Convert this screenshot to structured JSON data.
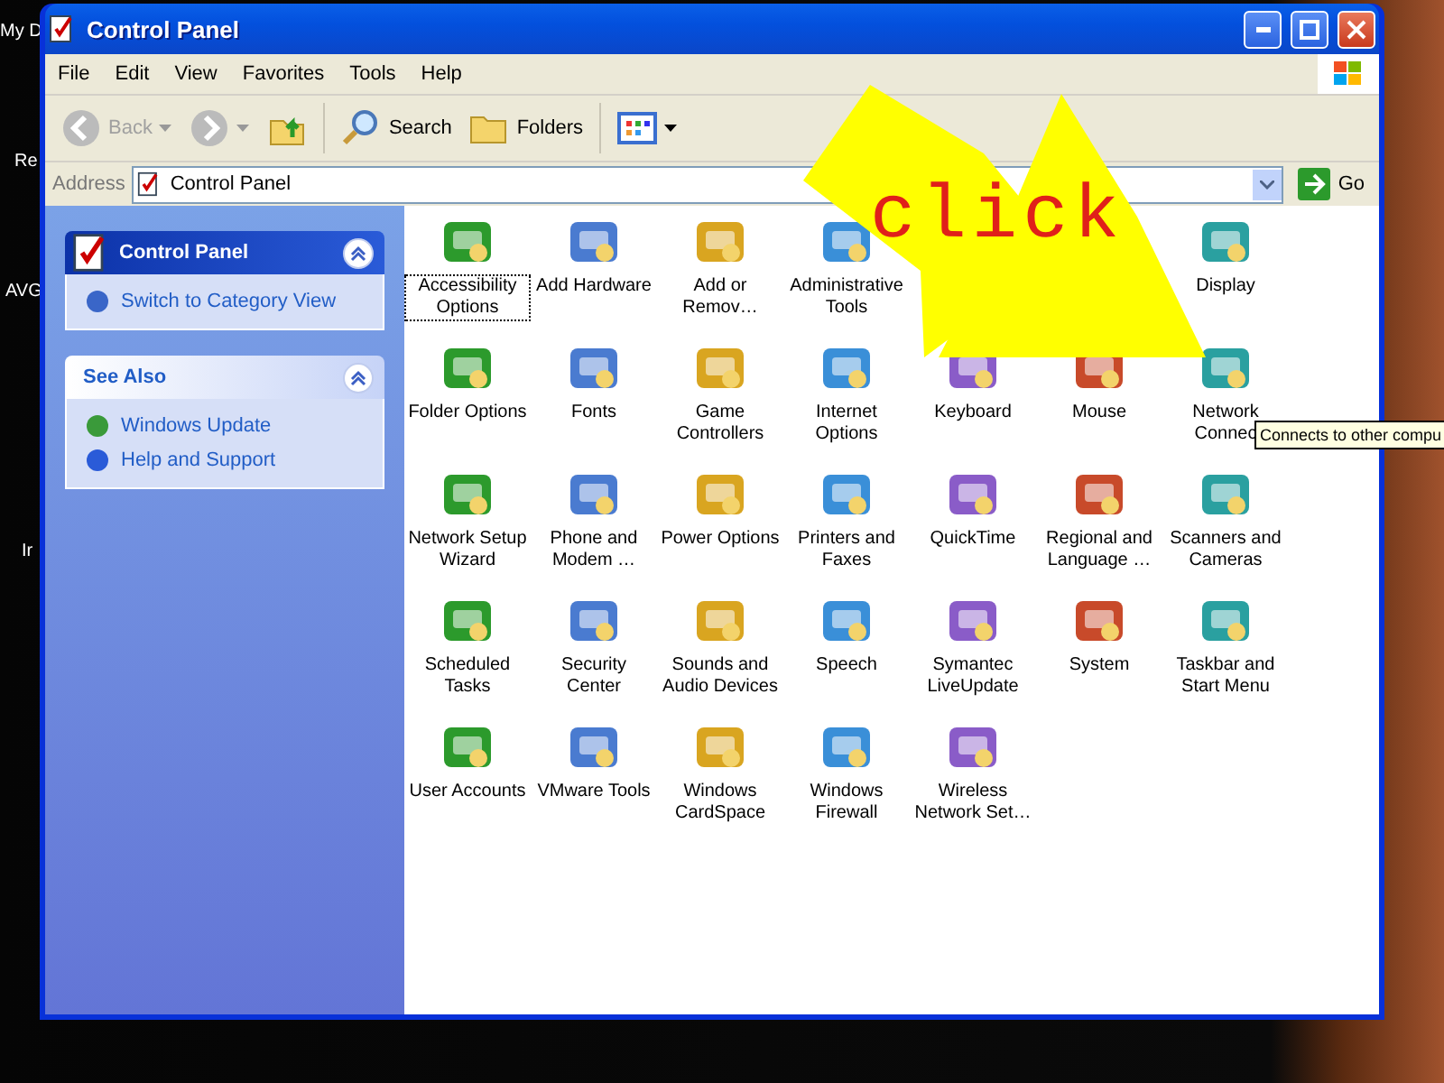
{
  "desktop": {
    "labels": [
      "My D",
      "Re",
      "AVG",
      "Ir"
    ]
  },
  "window": {
    "title": "Control Panel"
  },
  "menu": [
    "File",
    "Edit",
    "View",
    "Favorites",
    "Tools",
    "Help"
  ],
  "toolbar": {
    "back": {
      "label": "Back",
      "disabled": true
    },
    "forward": {
      "disabled": true
    },
    "search": "Search",
    "folders": "Folders"
  },
  "address": {
    "label": "Address",
    "value": "Control Panel",
    "go": "Go"
  },
  "sidebar": {
    "panels": [
      {
        "kind": "main",
        "title": "Control Panel",
        "links": [
          "Switch to Category View"
        ]
      },
      {
        "kind": "plain",
        "title": "See Also",
        "links": [
          "Windows Update",
          "Help and Support"
        ]
      }
    ]
  },
  "items": [
    {
      "kind": "icon",
      "label": "Accessibility Options",
      "selected": true
    },
    {
      "kind": "icon",
      "label": "Add Hardware",
      "selected": false
    },
    {
      "kind": "icon",
      "label": "Add or Remov…",
      "selected": false
    },
    {
      "kind": "icon",
      "label": "Administrative Tools",
      "selected": false
    },
    {
      "kind": "covered"
    },
    {
      "kind": "covered"
    },
    {
      "kind": "icon",
      "label": "Display",
      "selected": false
    },
    {
      "kind": "icon",
      "label": "Folder Options",
      "selected": false
    },
    {
      "kind": "icon",
      "label": "Fonts",
      "selected": false
    },
    {
      "kind": "icon",
      "label": "Game Controllers",
      "selected": false
    },
    {
      "kind": "icon",
      "label": "Internet Options",
      "selected": false
    },
    {
      "kind": "icon",
      "label": "Keyboard",
      "selected": false
    },
    {
      "kind": "icon",
      "label": "Mouse",
      "selected": false
    },
    {
      "kind": "icon",
      "label": "Network Connec",
      "selected": false
    },
    {
      "kind": "icon",
      "label": "Network Setup Wizard",
      "selected": false
    },
    {
      "kind": "icon",
      "label": "Phone and Modem …",
      "selected": false
    },
    {
      "kind": "icon",
      "label": "Power Options",
      "selected": false
    },
    {
      "kind": "icon",
      "label": "Printers and Faxes",
      "selected": false
    },
    {
      "kind": "icon",
      "label": "QuickTime",
      "selected": false
    },
    {
      "kind": "icon",
      "label": "Regional and Language …",
      "selected": false
    },
    {
      "kind": "icon",
      "label": "Scanners and Cameras",
      "selected": false
    },
    {
      "kind": "icon",
      "label": "Scheduled Tasks",
      "selected": false
    },
    {
      "kind": "icon",
      "label": "Security Center",
      "selected": false
    },
    {
      "kind": "icon",
      "label": "Sounds and Audio Devices",
      "selected": false
    },
    {
      "kind": "icon",
      "label": "Speech",
      "selected": false
    },
    {
      "kind": "icon",
      "label": "Symantec LiveUpdate",
      "selected": false
    },
    {
      "kind": "icon",
      "label": "System",
      "selected": false
    },
    {
      "kind": "icon",
      "label": "Taskbar and Start Menu",
      "selected": false
    },
    {
      "kind": "icon",
      "label": "User Accounts",
      "selected": false
    },
    {
      "kind": "icon",
      "label": "VMware Tools",
      "selected": false
    },
    {
      "kind": "icon",
      "label": "Windows CardSpace",
      "selected": false
    },
    {
      "kind": "icon",
      "label": "Windows Firewall",
      "selected": false
    },
    {
      "kind": "icon",
      "label": "Wireless Network Set…",
      "selected": false
    }
  ],
  "tooltip": "Connects to other compu",
  "annotation": {
    "text": "click"
  }
}
